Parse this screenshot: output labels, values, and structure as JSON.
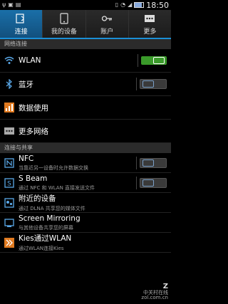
{
  "statusbar": {
    "time": "18:50"
  },
  "tabs": [
    {
      "label": "连接",
      "icon": "connections-icon",
      "active": true
    },
    {
      "label": "我的设备",
      "icon": "device-icon",
      "active": false
    },
    {
      "label": "账户",
      "icon": "key-icon",
      "active": false
    },
    {
      "label": "更多",
      "icon": "more-icon",
      "active": false
    }
  ],
  "sections": [
    {
      "header": "网络连接"
    },
    {
      "header": "连接与共享"
    }
  ],
  "rows": [
    {
      "title": "WLAN",
      "sub": "",
      "toggle": "on"
    },
    {
      "title": "蓝牙",
      "sub": "",
      "toggle": "off"
    },
    {
      "title": "数据使用",
      "sub": "",
      "toggle": ""
    },
    {
      "title": "更多网络",
      "sub": "",
      "toggle": ""
    },
    {
      "title": "NFC",
      "sub": "当靠近另一设备时允许数据交换",
      "toggle": "off"
    },
    {
      "title": "S Beam",
      "sub": "通过 NFC 和 WLAN 直接发送文件",
      "toggle": "off"
    },
    {
      "title": "附近的设备",
      "sub": "通过 DLNA 共享您的媒体文件",
      "toggle": ""
    },
    {
      "title": "Screen Mirroring",
      "sub": "与其他设备共享您的屏幕",
      "toggle": ""
    },
    {
      "title": "Kies通过WLAN",
      "sub": "通过WLAN连接Kies",
      "toggle": ""
    }
  ],
  "watermark": {
    "brand": "Z",
    "line1": "中关村在线",
    "line2": "zol.com.cn"
  }
}
